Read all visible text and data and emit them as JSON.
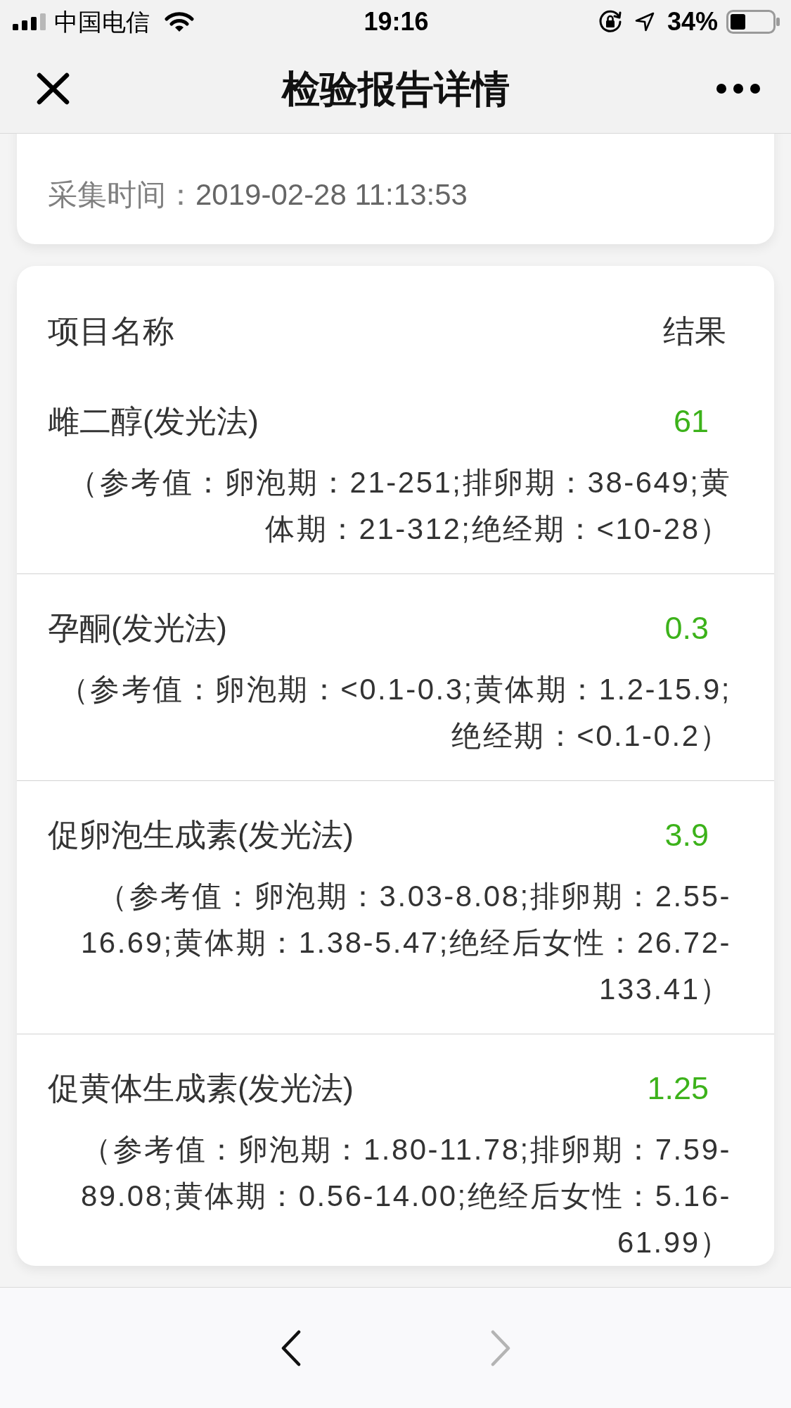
{
  "status_bar": {
    "carrier": "中国电信",
    "time": "19:16",
    "battery": "34%"
  },
  "nav": {
    "title": "检验报告详情"
  },
  "sample_info": [
    {
      "label": "采集时间：",
      "value": "2019-02-28 11:13:53"
    }
  ],
  "results": {
    "columns": [
      "项目名称",
      "结果"
    ],
    "rows": [
      {
        "name": "雌二醇(发光法)",
        "result": "61",
        "reference": "（参考值：卵泡期：21-251;排卵期：38-649;黄体期：21-312;绝经期：<10-28）"
      },
      {
        "name": "孕酮(发光法)",
        "result": "0.3",
        "reference": "（参考值：卵泡期：<0.1-0.3;黄体期：1.2-15.9;绝经期：<0.1-0.2）"
      },
      {
        "name": "促卵泡生成素(发光法)",
        "result": "3.9",
        "reference": "（参考值：卵泡期：3.03-8.08;排卵期：2.55-16.69;黄体期：1.38-5.47;绝经后女性：26.72-133.41）"
      },
      {
        "name": "促黄体生成素(发光法)",
        "result": "1.25",
        "reference": "（参考值：卵泡期：1.80-11.78;排卵期：7.59-89.08;黄体期：0.56-14.00;绝经后女性：5.16-61.99）"
      }
    ]
  },
  "toolbar": {
    "buttons": [
      {
        "kind": "back",
        "disabled": false
      },
      {
        "kind": "forward",
        "disabled": true
      }
    ]
  }
}
